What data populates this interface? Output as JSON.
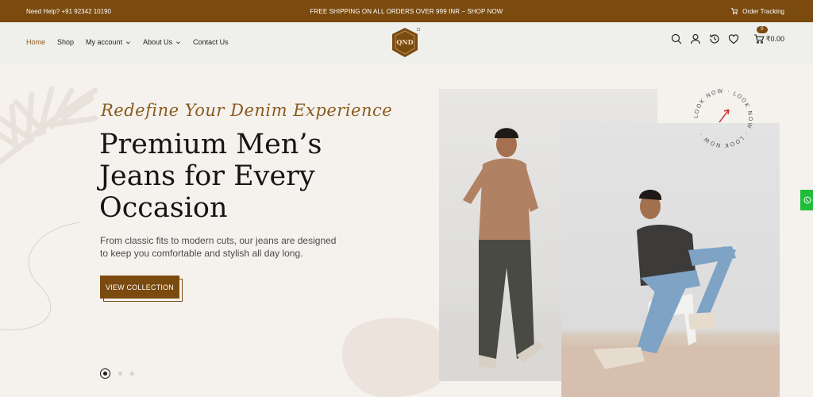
{
  "topbar": {
    "help": "Need Help? +91 92342 10190",
    "promo": "FREE SHIPPING ON ALL ORDERS OVER 999 INR  –  SHOP NOW",
    "tracking": "Order Tracking"
  },
  "nav": {
    "items": [
      {
        "label": "Home",
        "active": true
      },
      {
        "label": "Shop"
      },
      {
        "label": "My account",
        "dropdown": true
      },
      {
        "label": "About Us",
        "dropdown": true
      },
      {
        "label": "Contact Us"
      }
    ]
  },
  "logo": {
    "text": "QND"
  },
  "cart": {
    "count": "0",
    "total": "₹0.00"
  },
  "hero": {
    "tagline": "Redefine Your Denim Experience",
    "headline_lines": [
      "Premium Men’s",
      "Jeans for Every",
      "Occasion"
    ],
    "description": "From classic fits to modern cuts, our jeans are designed to keep you comfortable and stylish all day long.",
    "cta": "VIEW COLLECTION",
    "ring_text": "LOOK NOW · LOOK NOW · LOOK NOW ·"
  },
  "colors": {
    "brand": "#7a4a0f",
    "accent_text": "#8a5a1e",
    "background": "#f5f2ee",
    "whatsapp": "#1fbd3a"
  },
  "icons": [
    "cart-icon",
    "search-icon",
    "user-icon",
    "history-icon",
    "heart-icon",
    "whatsapp-icon",
    "chevron-down-icon"
  ]
}
